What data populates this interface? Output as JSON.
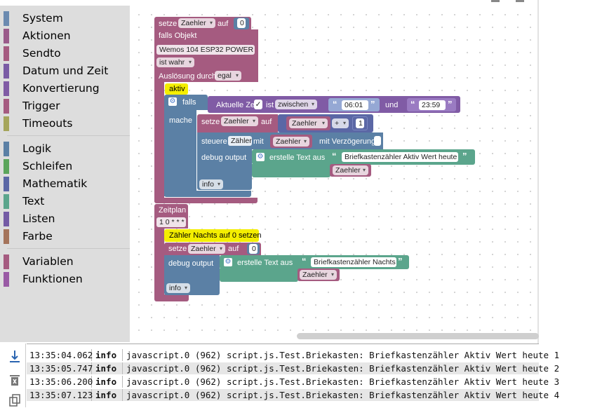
{
  "toolbox": {
    "categories": [
      {
        "label": "System",
        "color": "#6b8ab0"
      },
      {
        "label": "Aktionen",
        "color": "#9a5b8a"
      },
      {
        "label": "Sendto",
        "color": "#a55b80"
      },
      {
        "label": "Datum und Zeit",
        "color": "#7a5ba5"
      },
      {
        "label": "Konvertierung",
        "color": "#805ba5"
      },
      {
        "label": "Trigger",
        "color": "#a55b80"
      },
      {
        "label": "Timeouts",
        "color": "#a5a55b"
      },
      {
        "label": "Logik",
        "color": "#5b80a5"
      },
      {
        "label": "Schleifen",
        "color": "#5ba55b"
      },
      {
        "label": "Mathematik",
        "color": "#5b67a5"
      },
      {
        "label": "Text",
        "color": "#5ba58c"
      },
      {
        "label": "Listen",
        "color": "#745ba5"
      },
      {
        "label": "Farbe",
        "color": "#a5745b"
      },
      {
        "label": "Variablen",
        "color": "#a55b80"
      },
      {
        "label": "Funktionen",
        "color": "#995ba5"
      }
    ]
  },
  "blocks": {
    "set1": {
      "label": "setze",
      "var": "Zaehler",
      "to": "auf",
      "value": "0"
    },
    "trigger": {
      "label": "falls Objekt",
      "object": "Wemos 104 ESP32 POWER",
      "condition": "ist wahr",
      "trigger_label": "Auslösung durch",
      "trigger_value": "egal"
    },
    "comment1": "aktiv",
    "if": {
      "label": "falls",
      "do": "mache"
    },
    "time": {
      "label": "Aktuelle Zeit",
      "is": "ist",
      "op": "zwischen",
      "from": "06:01",
      "and": "und",
      "to": "23:59"
    },
    "set2": {
      "label": "setze",
      "var": "Zaehler",
      "to": "auf",
      "var2": "Zaehler",
      "op": "+",
      "value": "1"
    },
    "control": {
      "label": "steuere",
      "obj": "Zähler",
      "with": "mit",
      "var": "Zaehler",
      "delay": "mit Verzögerung"
    },
    "debug1": {
      "label": "debug output",
      "text_label": "erstelle Text aus",
      "text": "Briefkastenzähler Aktiv Wert heute",
      "var": "Zaehler",
      "level": "info"
    },
    "schedule": {
      "label": "Zeitplan",
      "cron": "1 0 * * *"
    },
    "comment2": "Zähler Nachts auf 0 setzen",
    "set3": {
      "label": "setze",
      "var": "Zaehler",
      "to": "auf",
      "value": "0"
    },
    "debug2": {
      "label": "debug output",
      "text_label": "erstelle Text aus",
      "text": "Briefkastenzähler Nachts",
      "var": "Zaehler",
      "level": "info"
    }
  },
  "log": {
    "rows": [
      {
        "time": "13:35:04.062",
        "severity": "info",
        "message": "javascript.0 (962) script.js.Test.Briekasten: Briefkastenzähler Aktiv Wert heute 1"
      },
      {
        "time": "13:35:05.747",
        "severity": "info",
        "message": "javascript.0 (962) script.js.Test.Briekasten: Briefkastenzähler Aktiv Wert heute 2"
      },
      {
        "time": "13:35:06.200",
        "severity": "info",
        "message": "javascript.0 (962) script.js.Test.Briekasten: Briefkastenzähler Aktiv Wert heute 3"
      },
      {
        "time": "13:35:07.123",
        "severity": "info",
        "message": "javascript.0 (962) script.js.Test.Briekasten: Briefkastenzähler Aktiv Wert heute 4"
      }
    ],
    "icons": [
      "scroll-bottom-icon",
      "clear-log-icon",
      "copy-icon"
    ]
  }
}
